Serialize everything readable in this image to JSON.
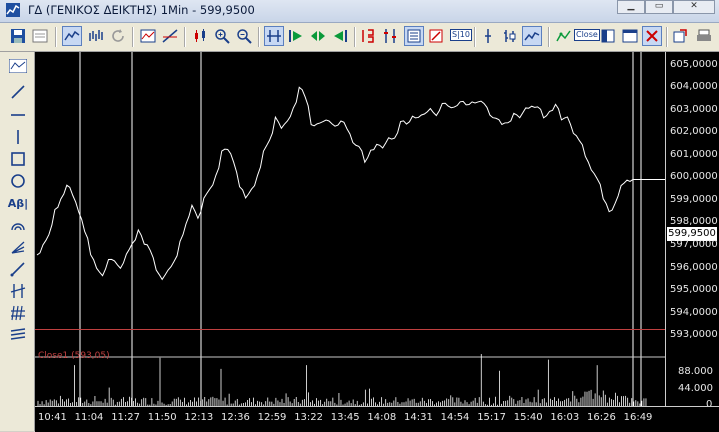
{
  "window": {
    "title": "ΓΔ (ΓΕΝΙΚΟΣ ΔΕΙΚΤΗΣ) 1Min - 599,9500"
  },
  "toolbar": {
    "close_label": "Close",
    "sig_label": "S|10"
  },
  "lefttools": {
    "text_tool_label": "Aβ|"
  },
  "colors": {
    "background": "#000000",
    "price_line": "#ffffff",
    "close_line": "#c04040",
    "volume": "#ffffff",
    "axis_text": "#e8e8e8"
  },
  "chart_data": {
    "type": "line",
    "price": {
      "ylim": [
        592.3,
        605.6
      ],
      "ticks": [
        "605,0000",
        "604,0000",
        "603,0000",
        "602,0000",
        "601,0000",
        "600,0000",
        "599,0000",
        "598,0000",
        "597,0000",
        "596,0000",
        "595,0000",
        "594,0000",
        "593,0000"
      ],
      "tick_values": [
        605,
        604,
        603,
        602,
        601,
        600,
        599,
        598,
        597,
        596,
        595,
        594,
        593
      ],
      "last_value": 599.95,
      "last_label": "599,9500",
      "series": [
        596.6,
        597.0,
        597.6,
        598.5,
        599.2,
        599.6,
        599.3,
        598.5,
        597.6,
        596.7,
        595.9,
        595.8,
        596.3,
        596.4,
        596.0,
        596.6,
        597.2,
        597.6,
        597.2,
        596.7,
        596.0,
        595.5,
        595.9,
        596.4,
        597.1,
        598.1,
        598.7,
        598.3,
        599.1,
        599.5,
        600.2,
        601.1,
        601.4,
        600.6,
        599.7,
        599.1,
        599.5,
        600.2,
        601.1,
        601.8,
        602.6,
        602.3,
        602.5,
        603.1,
        604.1,
        603.5,
        602.5,
        602.3,
        602.6,
        602.5,
        602.3,
        602.6,
        602.1,
        601.7,
        601.3,
        600.8,
        601.2,
        601.5,
        601.4,
        601.7,
        601.9,
        602.4,
        602.5,
        602.7,
        602.7,
        602.9,
        603.0,
        602.9,
        603.2,
        603.3,
        603.1,
        603.4,
        603.3,
        603.3,
        603.5,
        603.2,
        602.9,
        602.6,
        602.4,
        602.5,
        602.8,
        602.8,
        603.0,
        603.3,
        603.1,
        602.7,
        603.0,
        603.2,
        602.7,
        602.6,
        602.1,
        601.6,
        601.0,
        600.4,
        599.9,
        599.2,
        598.4,
        599.0,
        599.6,
        599.95,
        599.95
      ],
      "close_line_value": 593.3
    },
    "volume": {
      "ticks": [
        "88.000",
        "44.000",
        "0"
      ],
      "tick_values": [
        88000,
        44000,
        0
      ],
      "ymax": 132000,
      "spikes": [
        [
          6,
          110000
        ],
        [
          20,
          130000
        ],
        [
          30,
          100000
        ],
        [
          44,
          110000
        ],
        [
          73,
          140000
        ],
        [
          76,
          95000
        ],
        [
          84,
          125000
        ],
        [
          92,
          110000
        ]
      ],
      "series_label": "Close1 (593,05)"
    },
    "x_ticks": [
      "10:41",
      "11:04",
      "11:27",
      "11:50",
      "12:13",
      "12:36",
      "12:59",
      "13:22",
      "13:45",
      "14:08",
      "14:31",
      "14:54",
      "15:17",
      "15:40",
      "16:03",
      "16:26",
      "16:49"
    ]
  }
}
